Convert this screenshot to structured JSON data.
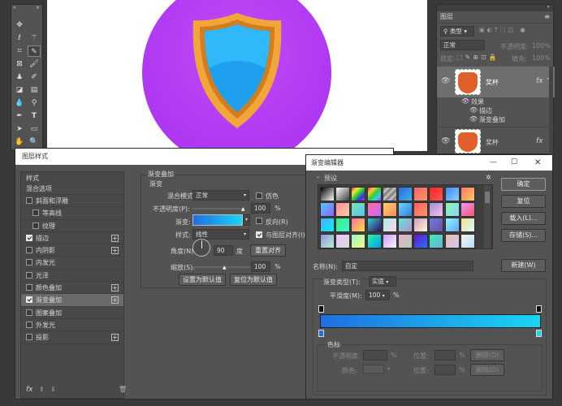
{
  "layers_panel": {
    "title": "图层",
    "kind_label": "类型",
    "blend": "正常",
    "opacity_label": "不透明度:",
    "opacity": "100%",
    "lock_label": "锁定:",
    "fill_label": "填充:",
    "fill": "100%",
    "layer1_name": "奖杯",
    "effects_label": "效果",
    "effect1": "描边",
    "effect2": "渐变叠加",
    "layer2_name": "奖杯",
    "fx": "fx"
  },
  "layer_style": {
    "title": "图层样式",
    "styles_header": "样式",
    "blend_options": "混合选项",
    "items": [
      "斜面和浮雕",
      "等高线",
      "纹理",
      "描边",
      "内阴影",
      "内发光",
      "光泽",
      "颜色叠加",
      "渐变叠加",
      "图案叠加",
      "外发光",
      "投影"
    ],
    "section_title": "渐变叠加",
    "sub_title": "渐变",
    "blend_mode_label": "混合模式:",
    "blend_mode": "正常",
    "dither_label": "仿色",
    "opacity_label": "不透明度(P):",
    "opacity_value": "100",
    "percent": "%",
    "gradient_label": "渐变:",
    "reverse_label": "反向(R)",
    "style_label": "样式:",
    "style_value": "线性",
    "align_label": "与图层对齐(I)",
    "angle_label": "角度(N):",
    "angle_value": "90",
    "degree": "度",
    "reset_align": "重置对齐",
    "scale_label": "缩放(S):",
    "scale_value": "100",
    "set_default": "设置为默认值",
    "reset_default": "复位为默认值",
    "footer_fx": "fx"
  },
  "gradient_editor": {
    "title": "渐变编辑器",
    "presets_label": "预设",
    "ok": "确定",
    "reset": "复位",
    "load": "载入(L)...",
    "save": "存储(S)...",
    "name_label": "名称(N):",
    "name_value": "自定",
    "new": "新建(W)",
    "type_label": "渐变类型(T):",
    "type_value": "实底",
    "smooth_label": "平滑度(M):",
    "smooth_value": "100",
    "percent": "%",
    "stops_label": "色标",
    "stop_opacity_label": "不透明度:",
    "stop_loc_label": "位置:",
    "delete": "删除(D)",
    "stop_color_label": "颜色:",
    "stop_loc2_label": "位置:",
    "delete2": "删除(D)"
  },
  "colors": {
    "gradient_start": "#1f6fe0",
    "gradient_end": "#19d6f4",
    "canvas_circle": "#b13cf5",
    "shield_gold": "#f2a63a"
  }
}
